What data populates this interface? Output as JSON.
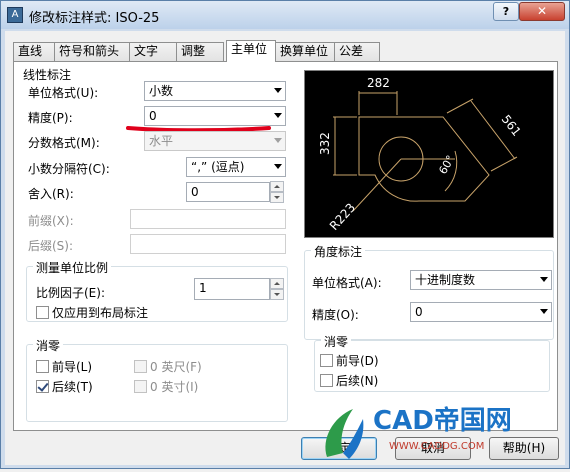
{
  "window": {
    "title": "修改标注样式: ISO-25",
    "help_button": "?",
    "close_button": "✕"
  },
  "tabs": [
    {
      "label": "直线",
      "active": false
    },
    {
      "label": "符号和箭头",
      "active": false
    },
    {
      "label": "文字",
      "active": false
    },
    {
      "label": "调整",
      "active": false
    },
    {
      "label": "主单位",
      "active": true
    },
    {
      "label": "换算单位",
      "active": false
    },
    {
      "label": "公差",
      "active": false
    }
  ],
  "linear": {
    "group_title": "线性标注",
    "unit_format_label": "单位格式(U):",
    "unit_format_value": "小数",
    "precision_label": "精度(P):",
    "precision_value": "0",
    "fraction_format_label": "分数格式(M):",
    "fraction_format_value": "水平",
    "decimal_separator_label": "小数分隔符(C):",
    "decimal_separator_value": "“,” (逗点)",
    "round_off_label": "舍入(R):",
    "round_off_value": "0",
    "prefix_label": "前缀(X):",
    "prefix_value": "",
    "suffix_label": "后缀(S):",
    "suffix_value": ""
  },
  "scale": {
    "group_title": "测量单位比例",
    "factor_label": "比例因子(E):",
    "factor_value": "1",
    "layout_only_label": "仅应用到布局标注",
    "layout_only_checked": false
  },
  "zero_linear": {
    "group_title": "消零",
    "leading_label": "前导(L)",
    "leading_checked": false,
    "trailing_label": "后续(T)",
    "trailing_checked": true,
    "feet_label": "0 英尺(F)",
    "feet_checked": false,
    "inches_label": "0 英寸(I)",
    "inches_checked": false
  },
  "preview": {
    "dim_top": "282",
    "dim_left": "332",
    "dim_right": "561",
    "dim_angle": "60°",
    "dim_radius": "R223"
  },
  "angular": {
    "group_title": "角度标注",
    "unit_format_label": "单位格式(A):",
    "unit_format_value": "十进制度数",
    "precision_label": "精度(O):",
    "precision_value": "0"
  },
  "zero_angular": {
    "group_title": "消零",
    "leading_label": "前导(D)",
    "leading_checked": false,
    "trailing_label": "后续(N)",
    "trailing_checked": false
  },
  "buttons": {
    "ok": "确定",
    "cancel": "取消",
    "help": "帮助(H)"
  },
  "watermark": {
    "brand": "CAD帝国网",
    "site": "WWW.CADDG.COM"
  },
  "colors": {
    "preview_lines": "#c8a36a",
    "annotation_red": "#e0001b",
    "logo_green": "#2d9b4a",
    "logo_blue": "#1b73c6"
  }
}
